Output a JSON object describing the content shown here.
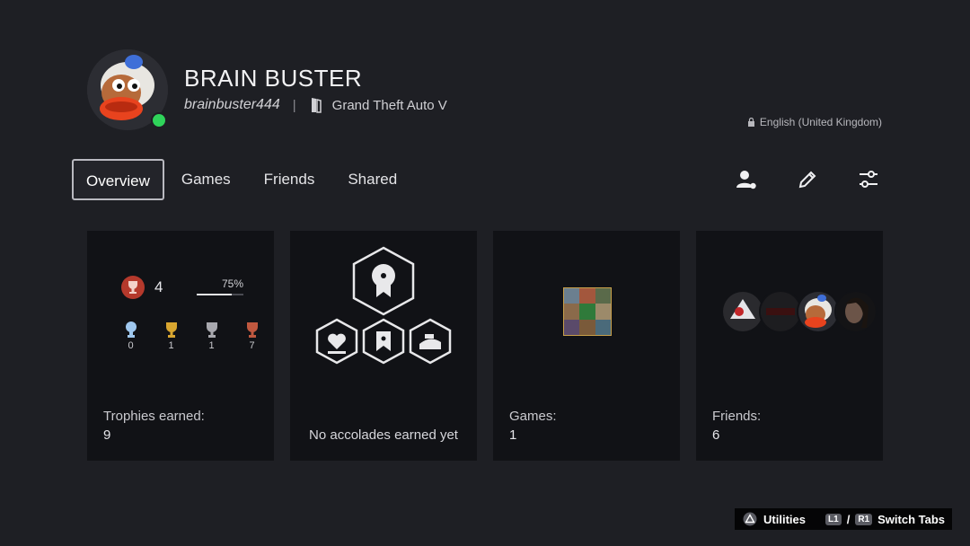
{
  "profile": {
    "name": "BRAIN BUSTER",
    "online_id": "brainbuster444",
    "separator": "|",
    "now_playing": "Grand Theft Auto V",
    "language": "English (United Kingdom)",
    "status_color": "#2fd35a"
  },
  "tabs": [
    {
      "label": "Overview",
      "active": true
    },
    {
      "label": "Games",
      "active": false
    },
    {
      "label": "Friends",
      "active": false
    },
    {
      "label": "Shared",
      "active": false
    }
  ],
  "actions": [
    "friend-request-icon",
    "edit-pencil-icon",
    "settings-sliders-icon"
  ],
  "trophies": {
    "level": "4",
    "progress_label": "75%",
    "progress": 0.75,
    "counts": {
      "platinum": "0",
      "gold": "1",
      "silver": "1",
      "bronze": "7"
    },
    "label": "Trophies earned:",
    "value": "9"
  },
  "accolades": {
    "empty_text": "No accolades earned yet"
  },
  "games": {
    "label": "Games:",
    "value": "1"
  },
  "friends": {
    "label": "Friends:",
    "value": "6"
  },
  "hints": {
    "utilities": "Utilities",
    "l1": "L1",
    "slash": "/",
    "r1": "R1",
    "switch_tabs": "Switch Tabs"
  }
}
